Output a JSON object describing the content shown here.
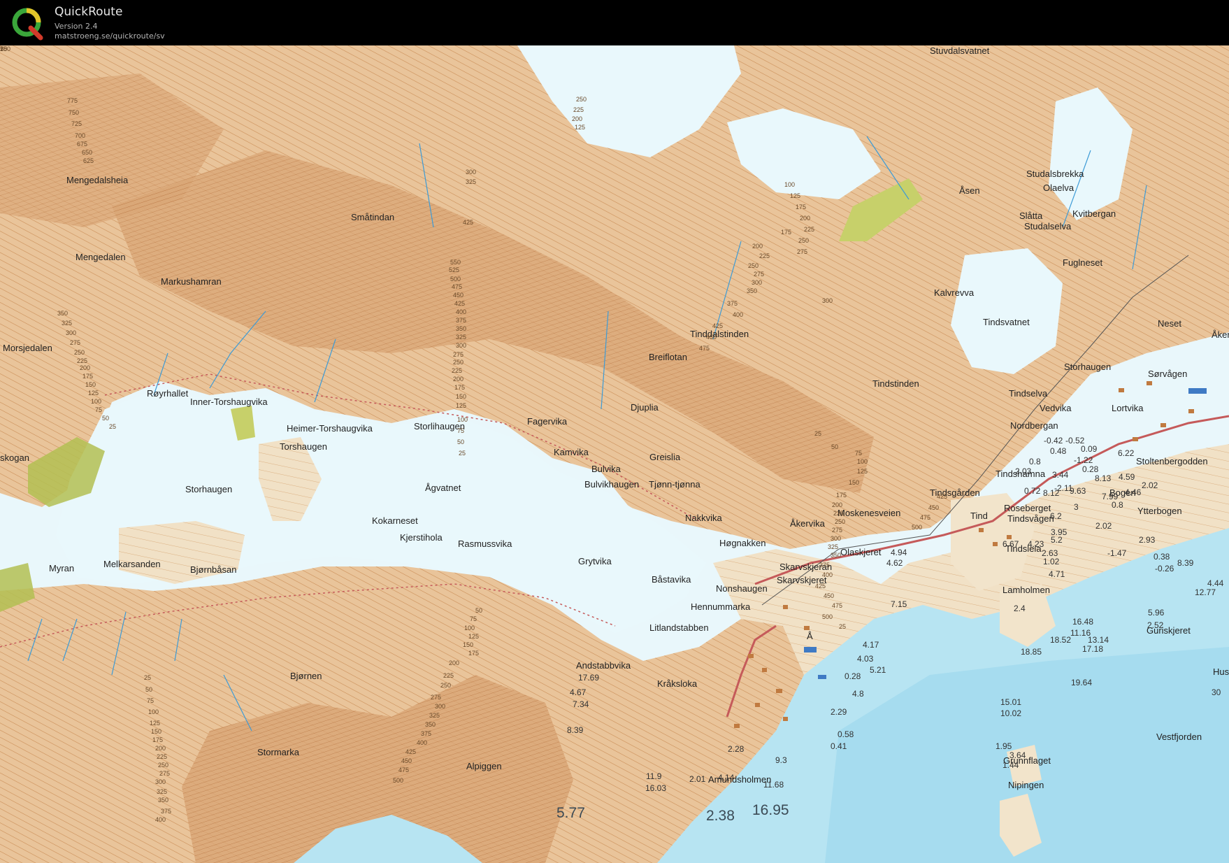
{
  "app": {
    "title": "QuickRoute",
    "version": "Version 2.4",
    "url": "matstroeng.se/quickroute/sv"
  },
  "colors": {
    "water_lake": "#e9f8fc",
    "water_sea": "#b7e4f2",
    "land": "#f1e1c6",
    "mountain": "#d9a878",
    "green": "#c7d06a",
    "contour": "#c98a52"
  },
  "map": {
    "place_names": [
      "Stuvdalsvatnet",
      "Mengedalsheia",
      "Småtindan",
      "Mengedalen",
      "Markushamran",
      "Morsjedalen",
      "Røyrhallet",
      "Inner-Torshaugvika",
      "Heimer-Torshaugvika",
      "Torshaugen",
      "Storlihaugen",
      "skogan",
      "Storhaugen",
      "Myran",
      "Melkarsanden",
      "Bjørnbåsan",
      "Ågvatnet",
      "Fagervika",
      "Kamvika",
      "Bulvika",
      "Bulvikhaugen",
      "Djuplia",
      "Greislia",
      "Tjønn-tjønna",
      "Breiflotan",
      "Tinddalstinden",
      "Åsen",
      "Studalsbrekka",
      "Olaelva",
      "Slåtta",
      "Kvitbergan",
      "Studalselva",
      "Fuglneset",
      "Kalvrevva",
      "Tindsvatnet",
      "Neset",
      "Åkern",
      "Storhaugen",
      "Sørvågen",
      "Tindstinden",
      "Tindselva",
      "Vedvika",
      "Lortvika",
      "Nordbergan",
      "Stoltenbergodden",
      "Tindshamna",
      "Tindsgården",
      "Bogen",
      "Roseberget",
      "Tind",
      "Tindsvågen",
      "Ytterbogen",
      "Moskenesveien",
      "Åkervika",
      "Nakkvika",
      "Høgnakken",
      "Olaskjeret",
      "Tindsleia",
      "Skarvskjeran",
      "Skarvskjeret",
      "Kokarneset",
      "Kjerstihola",
      "Rasmussvika",
      "Grytvika",
      "Båstavika",
      "Nonshaugen",
      "Hennummarka",
      "Litlandstabben",
      "Å",
      "Lamholmen",
      "Guriskjeret",
      "Andstabbvika",
      "Kråksloka",
      "Bjørnen",
      "Stormarka",
      "Alpiggen",
      "Grunnflaget",
      "Vestfjorden",
      "Amundsholmen",
      "Nipingen",
      "Hus"
    ],
    "depths": [
      "-0.42",
      "-0.52",
      "0.09",
      "0.48",
      "-1.22",
      "0.28",
      "0.8",
      "6.22",
      "2.03",
      "3.44",
      "8.13",
      "4.59",
      "2.02",
      "0.72",
      "-2.11",
      "8.12",
      "9.63",
      "4.46",
      "7.99",
      "3",
      "0.8",
      "6.2",
      "2.02",
      "3.95",
      "5.2",
      "6.67",
      "4.23",
      "2.93",
      "2.63",
      "1.02",
      "4.71",
      "-1.47",
      "0.38",
      "-0.26",
      "8.39",
      "4.44",
      "12.77",
      "4.94",
      "4.62",
      "7.15",
      "2.4",
      "5.96",
      "16.48",
      "2.52",
      "11.16",
      "18.52",
      "13.14",
      "17.18",
      "18.85",
      "4.17",
      "4.03",
      "5.21",
      "0.28",
      "4.8",
      "19.64",
      "30",
      "17.69",
      "4.67",
      "7.34",
      "8.39",
      "2.29",
      "15.01",
      "10.02",
      "0.58",
      "0.41",
      "2.28",
      "1.95",
      "3.64",
      "1.44",
      "9.3",
      "11.9",
      "2.01",
      "4.14",
      "16.03",
      "11.68"
    ],
    "large_labels": [
      "5.77",
      "2.38",
      "16.95"
    ],
    "contour_labels": [
      "775",
      "750",
      "725",
      "700",
      "675",
      "650",
      "625",
      "300",
      "325",
      "425",
      "250",
      "225",
      "200",
      "125",
      "550",
      "525",
      "500",
      "475",
      "450",
      "425",
      "400",
      "375",
      "350",
      "325",
      "300",
      "275",
      "250",
      "225",
      "200",
      "175",
      "150",
      "125",
      "100",
      "75",
      "50",
      "25",
      "350",
      "325",
      "300",
      "275",
      "250",
      "225",
      "200",
      "175",
      "150",
      "125",
      "100",
      "75",
      "50",
      "25",
      "175",
      "200",
      "225",
      "250",
      "275",
      "300",
      "350",
      "375",
      "400",
      "425",
      "450",
      "475",
      "100",
      "125",
      "175",
      "200",
      "225",
      "250",
      "275",
      "300",
      "25",
      "50",
      "75",
      "100",
      "125",
      "150",
      "175",
      "200",
      "225",
      "250",
      "275",
      "300",
      "325",
      "350",
      "375",
      "400",
      "425",
      "450",
      "475",
      "500",
      "25",
      "50",
      "75",
      "100",
      "125",
      "150",
      "175",
      "200",
      "225",
      "250",
      "275",
      "300",
      "325",
      "350",
      "375",
      "400",
      "425",
      "450",
      "475",
      "500",
      "25",
      "50",
      "75",
      "100",
      "125",
      "150",
      "175",
      "200",
      "225",
      "250",
      "275",
      "300",
      "325",
      "350",
      "375",
      "400",
      "425",
      "450",
      "475",
      "500",
      "100",
      "75",
      "50",
      "25"
    ]
  }
}
